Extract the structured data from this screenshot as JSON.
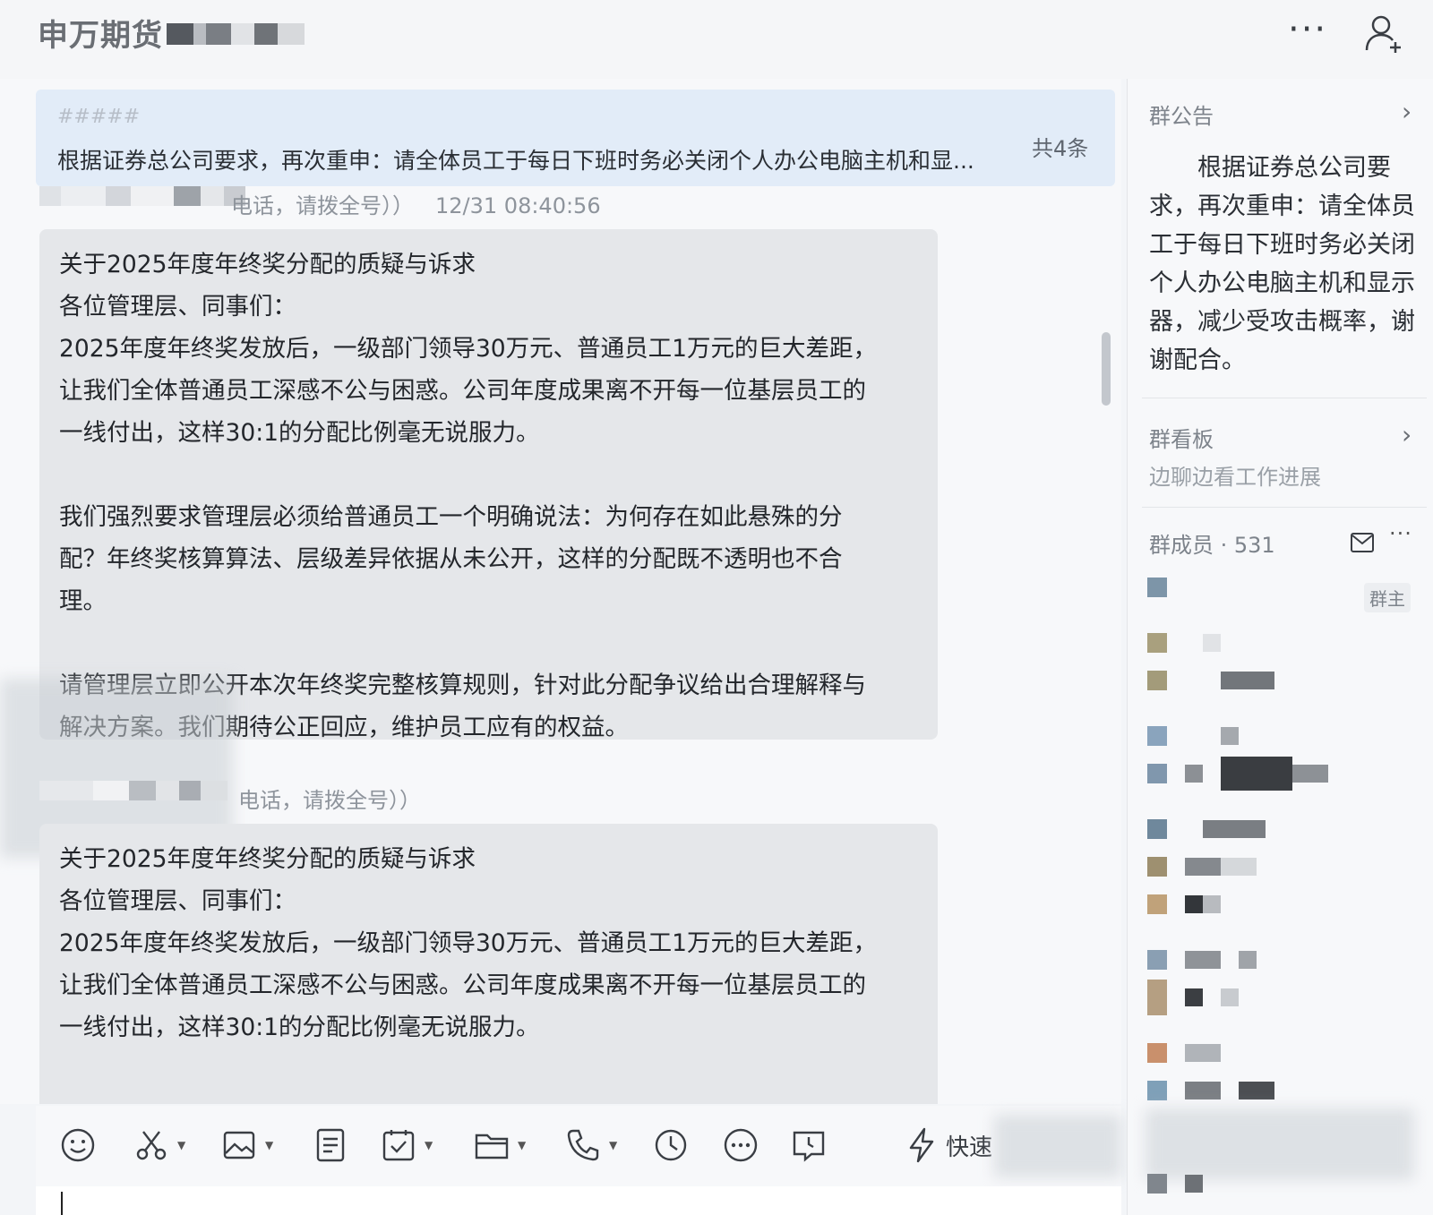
{
  "header": {
    "title": "申万期货"
  },
  "pinned": {
    "label": "#####",
    "text": "根据证券总公司要求，再次重申：请全体员工于每日下班时务必关闭个人办公电脑主机和显...",
    "count": "共4条"
  },
  "messages": [
    {
      "sender_suffix": "电话，请拨全号））",
      "time": "12/31 08:40:56",
      "lines": [
        "关于2025年度年终奖分配的质疑与诉求",
        "各位管理层、同事们：",
        "2025年度年终奖发放后，一级部门领导30万元、普通员工1万元的巨大差距，",
        "让我们全体普通员工深感不公与困惑。公司年度成果离不开每一位基层员工的",
        "一线付出，这样30:1的分配比例毫无说服力。",
        "",
        "我们强烈要求管理层必须给普通员工一个明确说法：为何存在如此悬殊的分",
        "配？年终奖核算算法、层级差异依据从未公开，这样的分配既不透明也不合",
        "理。",
        "",
        "请管理层立即公开本次年终奖完整核算规则，针对此分配争议给出合理解释与",
        "解决方案。我们期待公正回应，维护员工应有的权益。"
      ]
    },
    {
      "sender_suffix": "电话，请拨全号））",
      "time": "",
      "lines": [
        "关于2025年度年终奖分配的质疑与诉求",
        "各位管理层、同事们：",
        "2025年度年终奖发放后，一级部门领导30万元、普通员工1万元的巨大差距，",
        "让我们全体普通员工深感不公与困惑。公司年度成果离不开每一位基层员工的",
        "一线付出，这样30:1的分配比例毫无说服力。"
      ]
    }
  ],
  "toolbar": {
    "quick_label": "快速"
  },
  "right_panel": {
    "announcement": {
      "title": "群公告",
      "text": "根据证券总公司要求，再次重申：请全体员工于每日下班时务必关闭个人办公电脑主机和显示器，减少受攻击概率，谢谢配合。"
    },
    "board": {
      "title": "群看板",
      "subtitle": "边聊边看工作进展"
    },
    "members": {
      "title": "群成员 · 531",
      "owner_tag": "群主"
    }
  },
  "icons": [
    "more-icon",
    "add-member-icon",
    "emoji-icon",
    "scissors-icon",
    "image-icon",
    "document-icon",
    "task-icon",
    "folder-icon",
    "phone-icon",
    "clock-icon",
    "more-circle-icon",
    "message-clock-icon",
    "lightning-icon",
    "mail-icon"
  ]
}
